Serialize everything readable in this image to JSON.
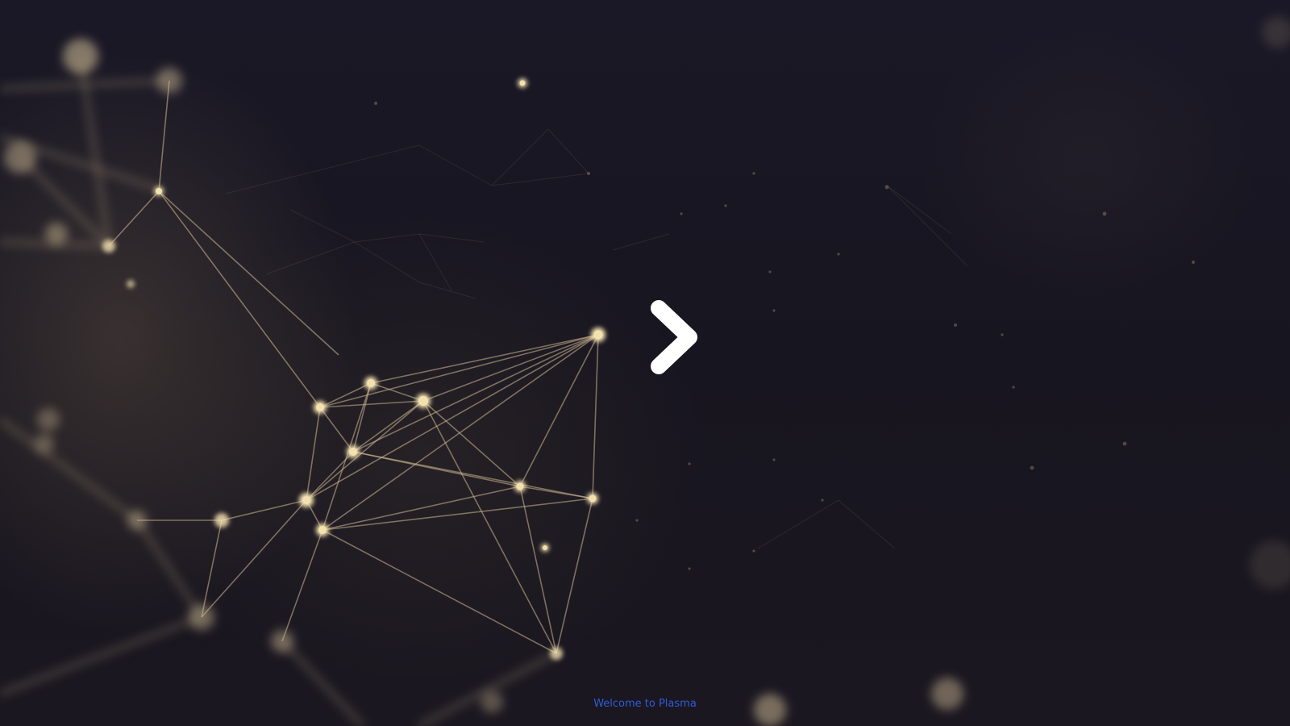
{
  "splash": {
    "welcome_text": "Welcome to Plasma",
    "logo_icon": "chevron-right-icon"
  },
  "colors": {
    "background": "#15141f",
    "network_line": "#c9b48f",
    "network_node": "#f3e2b0",
    "logo": "#ffffff",
    "welcome_text": "#2f5bd8"
  }
}
